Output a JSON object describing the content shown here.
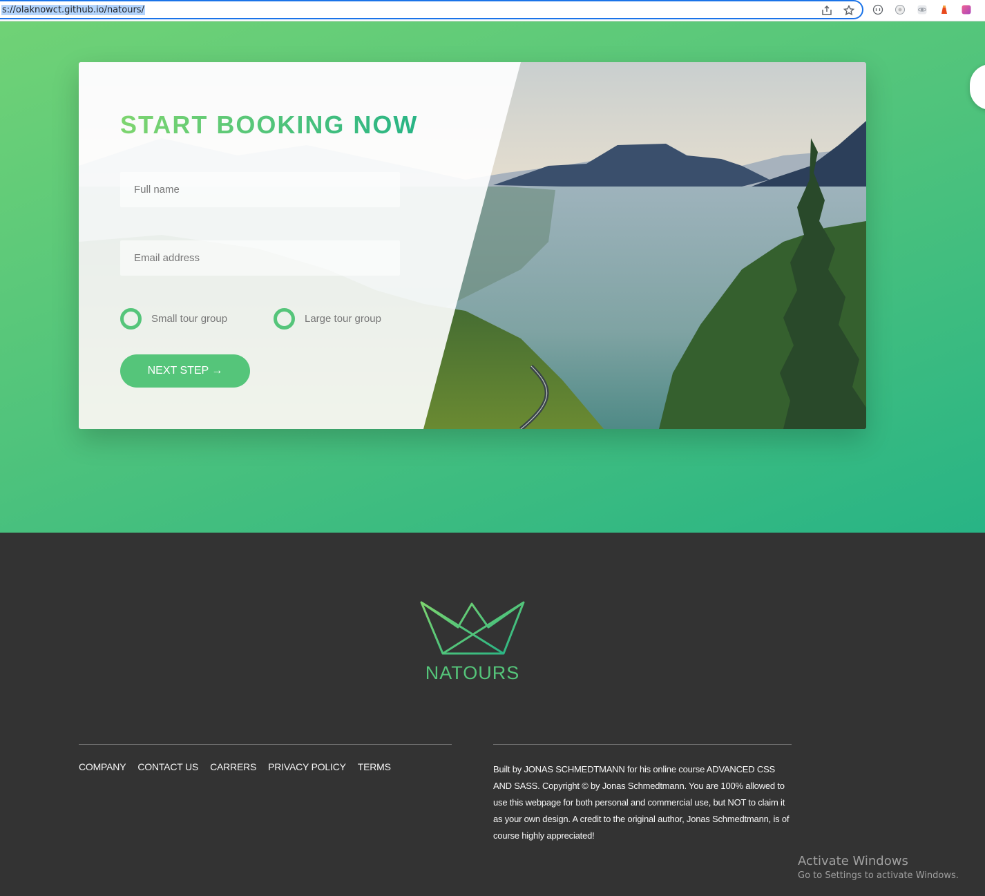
{
  "browser": {
    "url": "s://olaknowct.github.io/natours/",
    "actions": [
      "share-icon",
      "star-icon"
    ],
    "extensions": [
      "extension-icon-1",
      "extension-icon-2",
      "extension-icon-3",
      "extension-icon-4",
      "extension-icon-5"
    ]
  },
  "side_menu": {
    "icon": "menu-icon",
    "glyph": "⋮"
  },
  "booking": {
    "title": "START BOOKING NOW",
    "name_placeholder": "Full name",
    "email_placeholder": "Email address",
    "radio_small": "Small tour group",
    "radio_large": "Large tour group",
    "next_button": "NEXT STEP →",
    "accent_color": "#55c57a"
  },
  "footer": {
    "logo_text": "NATOURS",
    "nav": [
      "COMPANY",
      "CONTACT US",
      "CARRERS",
      "PRIVACY POLICY",
      "TERMS"
    ],
    "copyright": "Built by JONAS SCHMEDTMANN for his online course ADVANCED CSS AND SASS. Copyright © by Jonas Schmedtmann. You are 100% allowed to use this webpage for both personal and commercial use, but NOT to claim it as your own design. A credit to the original author, Jonas Schmedtmann, is of course highly appreciated!"
  },
  "os_watermark": {
    "title": "Activate Windows",
    "subtitle": "Go to Settings to activate Windows."
  }
}
